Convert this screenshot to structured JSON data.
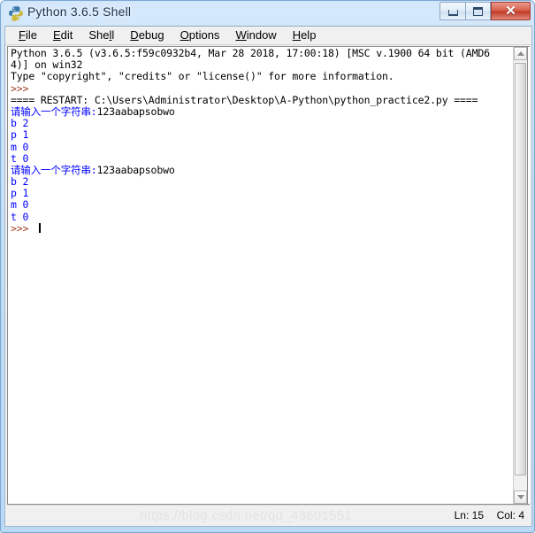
{
  "window": {
    "title": "Python 3.6.5 Shell",
    "icon": "python-logo-icon",
    "controls": {
      "minimize_label": "–",
      "maximize_label": "□",
      "close_label": "✕"
    },
    "colors": {
      "titlebar_glass": "#c3dff6",
      "close_button": "#c03b28",
      "text_default": "#000000",
      "text_output": "#0000ff",
      "text_prompt": "#a03c20",
      "client_background": "#ffffff"
    }
  },
  "menu": {
    "items": [
      {
        "label": "File",
        "accel": "F"
      },
      {
        "label": "Edit",
        "accel": "E"
      },
      {
        "label": "Shell",
        "accel": "l"
      },
      {
        "label": "Debug",
        "accel": "D"
      },
      {
        "label": "Options",
        "accel": "O"
      },
      {
        "label": "Window",
        "accel": "W"
      },
      {
        "label": "Help",
        "accel": "H"
      }
    ]
  },
  "shell": {
    "lines": [
      {
        "text": "Python 3.6.5 (v3.6.5:f59c0932b4, Mar 28 2018, 17:00:18) [MSC v.1900 64 bit (AMD6",
        "color": "black"
      },
      {
        "text": "4)] on win32",
        "color": "black"
      },
      {
        "text": "Type \"copyright\", \"credits\" or \"license()\" for more information.",
        "color": "black"
      },
      {
        "text": ">>> ",
        "color": "brown"
      },
      {
        "text": "==== RESTART: C:\\Users\\Administrator\\Desktop\\A-Python\\python_practice2.py ====",
        "color": "black"
      },
      {
        "text": "请输入一个字符串:",
        "color": "blue",
        "suffix": "123aabapsobwo",
        "suffix_color": "black"
      },
      {
        "text": "b 2",
        "color": "blue"
      },
      {
        "text": "p 1",
        "color": "blue"
      },
      {
        "text": "m 0",
        "color": "blue"
      },
      {
        "text": "t 0",
        "color": "blue"
      },
      {
        "text": "请输入一个字符串:",
        "color": "blue",
        "suffix": "123aabapsobwo",
        "suffix_color": "black"
      },
      {
        "text": "b 2",
        "color": "blue"
      },
      {
        "text": "p 1",
        "color": "blue"
      },
      {
        "text": "m 0",
        "color": "blue"
      },
      {
        "text": "t 0",
        "color": "blue"
      },
      {
        "text": ">>> ",
        "color": "brown",
        "cursor": true
      }
    ]
  },
  "scrollbar": {
    "up_arrow": "scroll-up-arrow",
    "down_arrow": "scroll-down-arrow"
  },
  "status_bar": {
    "line_label": "Ln: 15",
    "column_label": "Col: 4",
    "watermark": "https://blog.csdn.net/qq_43601551"
  }
}
